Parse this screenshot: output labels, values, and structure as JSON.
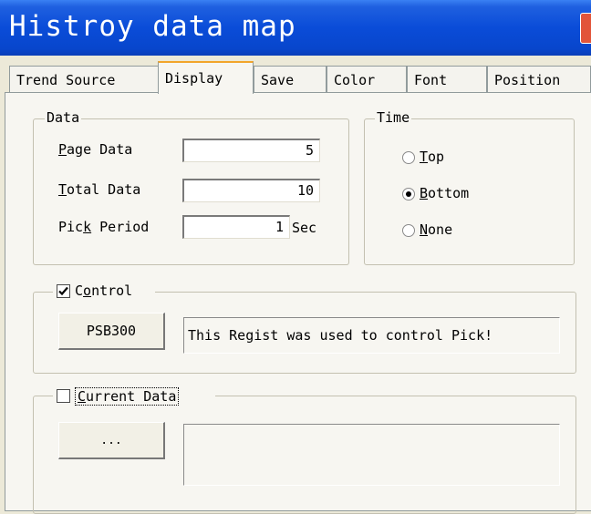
{
  "window": {
    "title": "Histroy data map"
  },
  "tabs": [
    "Trend Source",
    "Display",
    "Save",
    "Color",
    "Font",
    "Position"
  ],
  "active_tab": "Display",
  "data_group": {
    "legend": "Data",
    "page_data": {
      "label_underline": "P",
      "label_rest": "age Data",
      "value": "5"
    },
    "total_data": {
      "label_underline": "T",
      "label_rest": "otal Data",
      "value": "10"
    },
    "pick_period": {
      "label_before": "Pic",
      "label_underline": "k",
      "label_after": " Period",
      "value": "1",
      "unit": "Sec"
    }
  },
  "time_group": {
    "legend": "Time",
    "options": [
      {
        "underline": "T",
        "rest": "op",
        "selected": false
      },
      {
        "underline": "B",
        "rest": "ottom",
        "selected": true
      },
      {
        "underline": "N",
        "rest": "one",
        "selected": false
      }
    ]
  },
  "control_group": {
    "checked": true,
    "label_before": "C",
    "label_underline": "o",
    "label_after": "ntrol",
    "register_button": "PSB300",
    "description": "This Regist was used to control Pick!"
  },
  "current_data_group": {
    "checked": false,
    "label_underline": "C",
    "label_rest": "urrent Data",
    "browse_button": "...",
    "description": ""
  }
}
